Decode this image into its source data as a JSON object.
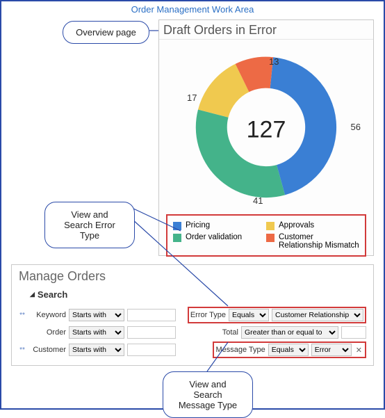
{
  "page_title": "Order Management Work Area",
  "callouts": {
    "overview": "Overview page",
    "error_type": "View and Search Error Type",
    "message_type": "View and Search Message Type"
  },
  "chart": {
    "title": "Draft Orders in Error",
    "total": "127"
  },
  "chart_data": {
    "type": "pie",
    "title": "Draft Orders in Error",
    "total": 127,
    "series": [
      {
        "name": "Pricing",
        "value": 56,
        "color": "#3a7fd4"
      },
      {
        "name": "Order validation",
        "value": 41,
        "color": "#44b38a"
      },
      {
        "name": "Approvals",
        "value": 17,
        "color": "#f0c94f"
      },
      {
        "name": "Customer Relationship Mismatch",
        "value": 13,
        "color": "#ed6a45"
      }
    ]
  },
  "legend": {
    "items": [
      {
        "label": "Pricing",
        "color": "#3a7fd4"
      },
      {
        "label": "Approvals",
        "color": "#f0c94f"
      },
      {
        "label": "Order validation",
        "color": "#44b38a"
      },
      {
        "label": "Customer Relationship Mismatch",
        "color": "#ed6a45"
      }
    ]
  },
  "manage": {
    "title": "Manage Orders",
    "search_heading": "Search",
    "required_marker": "**",
    "operators": {
      "starts_with": "Starts with",
      "equals": "Equals",
      "gte": "Greater than or equal to"
    },
    "rows": {
      "keyword": {
        "label": "Keyword",
        "op": "Starts with",
        "value": ""
      },
      "order": {
        "label": "Order",
        "op": "Starts with",
        "value": ""
      },
      "customer": {
        "label": "Customer",
        "op": "Starts with",
        "value": ""
      },
      "error_type": {
        "label": "Error Type",
        "op": "Equals",
        "value": "Customer Relationship"
      },
      "total": {
        "label": "Total",
        "op": "Greater than or equal to",
        "value": ""
      },
      "message_type": {
        "label": "Message Type",
        "op": "Equals",
        "value": "Error"
      }
    }
  }
}
